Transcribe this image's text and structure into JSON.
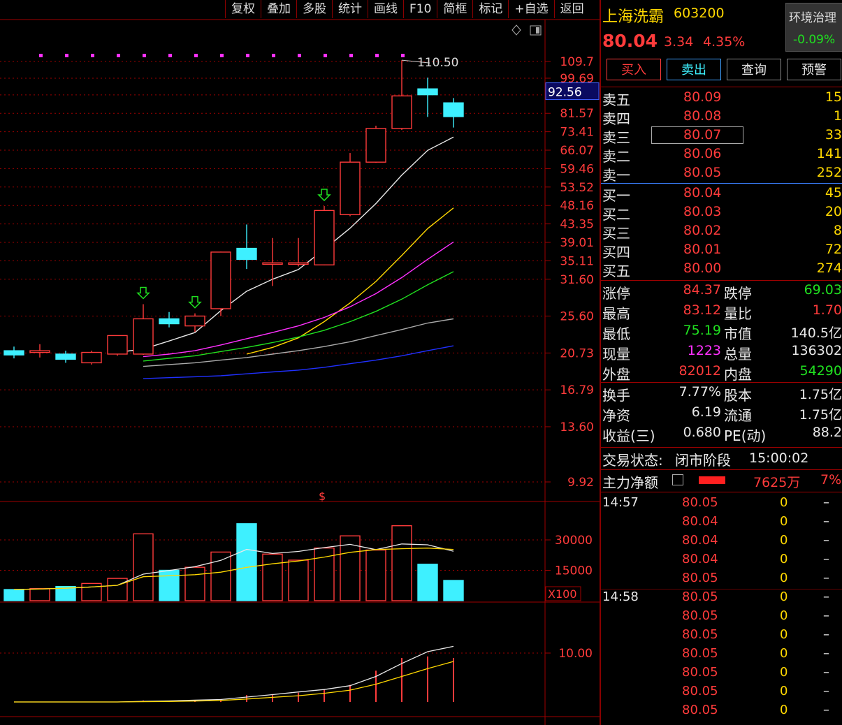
{
  "toolbar": [
    "复权",
    "叠加",
    "多股",
    "统计",
    "画线",
    "F10",
    "简框",
    "标记",
    "+自选",
    "返回"
  ],
  "stock": {
    "name": "上海洗霸",
    "code": "603200",
    "price": "80.04",
    "change": "3.34",
    "change_pct": "4.35%",
    "sector": "环境治理",
    "sector_change": "-0.09%"
  },
  "buttons": {
    "buy": "买入",
    "sell": "卖出",
    "query": "查询",
    "alert": "预警"
  },
  "order_book": {
    "asks": [
      {
        "label": "卖五",
        "price": "80.09",
        "vol": "15"
      },
      {
        "label": "卖四",
        "price": "80.08",
        "vol": "1"
      },
      {
        "label": "卖三",
        "price": "80.07",
        "vol": "33"
      },
      {
        "label": "卖二",
        "price": "80.06",
        "vol": "141"
      },
      {
        "label": "卖一",
        "price": "80.05",
        "vol": "252"
      }
    ],
    "bids": [
      {
        "label": "买一",
        "price": "80.04",
        "vol": "45"
      },
      {
        "label": "买二",
        "price": "80.03",
        "vol": "20"
      },
      {
        "label": "买三",
        "price": "80.02",
        "vol": "8"
      },
      {
        "label": "买四",
        "price": "80.01",
        "vol": "72"
      },
      {
        "label": "买五",
        "price": "80.00",
        "vol": "274"
      }
    ]
  },
  "stats": {
    "zt_label": "涨停",
    "zt": "84.37",
    "dt_label": "跌停",
    "dt": "69.03",
    "high_label": "最高",
    "high": "83.12",
    "lb_label": "量比",
    "lb": "1.70",
    "low_label": "最低",
    "low": "75.19",
    "mv_label": "市值",
    "mv": "140.5亿",
    "cur_vol_label": "现量",
    "cur_vol": "1223",
    "total_vol_label": "总量",
    "total_vol": "136302",
    "outer_label": "外盘",
    "outer": "82012",
    "inner_label": "内盘",
    "inner": "54290",
    "turnover_label": "换手",
    "turnover": "7.77%",
    "capital_label": "股本",
    "capital": "1.75亿",
    "nav_label": "净资",
    "nav": "6.19",
    "float_label": "流通",
    "float_cap": "1.75亿",
    "eps_label": "收益(三)",
    "eps": "0.680",
    "pe_label": "PE(动)",
    "pe": "88.2"
  },
  "status": {
    "label": "交易状态:",
    "state": "闭市阶段",
    "time": "15:00:02"
  },
  "main_flow": {
    "label": "主力净额",
    "amount": "7625万",
    "pct": "7%"
  },
  "ticks": [
    {
      "time": "14:57",
      "price": "80.05",
      "vol": "0",
      "dir": "–"
    },
    {
      "time": "",
      "price": "80.04",
      "vol": "0",
      "dir": "–"
    },
    {
      "time": "",
      "price": "80.04",
      "vol": "0",
      "dir": "–"
    },
    {
      "time": "",
      "price": "80.04",
      "vol": "0",
      "dir": "–"
    },
    {
      "time": "",
      "price": "80.05",
      "vol": "0",
      "dir": "–"
    },
    {
      "time": "14:58",
      "price": "80.05",
      "vol": "0",
      "dir": "–"
    },
    {
      "time": "",
      "price": "80.05",
      "vol": "0",
      "dir": "–"
    },
    {
      "time": "",
      "price": "80.05",
      "vol": "0",
      "dir": "–"
    },
    {
      "time": "",
      "price": "80.05",
      "vol": "0",
      "dir": "–"
    },
    {
      "time": "",
      "price": "80.05",
      "vol": "0",
      "dir": "–"
    },
    {
      "time": "",
      "price": "80.05",
      "vol": "0",
      "dir": "–"
    },
    {
      "time": "",
      "price": "80.05",
      "vol": "0",
      "dir": "–"
    }
  ],
  "colors": {
    "up": "#ff3b3b",
    "down": "#3ef0ff",
    "grid": "#a00000",
    "ma5": "#e8e8e8",
    "ma10": "#ffd800",
    "ma20": "#ff30ff",
    "ma30": "#20e020",
    "ma60": "#aaaaaa",
    "ma120": "#2030ff"
  },
  "chart_data": {
    "type": "candlestick",
    "price_axis_ticks": [
      "109.7",
      "99.69",
      "90.63",
      "81.57",
      "73.41",
      "66.07",
      "59.46",
      "53.52",
      "48.16",
      "43.35",
      "39.01",
      "35.11",
      "31.60",
      "25.60",
      "20.73",
      "16.79",
      "13.60",
      "9.92"
    ],
    "price_axis_scale": "log",
    "crosshair_price": "92.56",
    "max_label": "110.50",
    "candles": [
      {
        "o": 21.0,
        "h": 21.5,
        "l": 20.1,
        "c": 20.5
      },
      {
        "o": 20.8,
        "h": 21.8,
        "l": 20.2,
        "c": 21.0
      },
      {
        "o": 20.6,
        "h": 21.0,
        "l": 19.6,
        "c": 20.0
      },
      {
        "o": 19.6,
        "h": 21.0,
        "l": 19.4,
        "c": 20.8
      },
      {
        "o": 20.6,
        "h": 22.9,
        "l": 20.4,
        "c": 22.9
      },
      {
        "o": 20.6,
        "h": 27.4,
        "l": 20.5,
        "c": 25.2
      },
      {
        "o": 25.2,
        "h": 26.2,
        "l": 24.0,
        "c": 24.5
      },
      {
        "o": 24.2,
        "h": 26.0,
        "l": 23.4,
        "c": 25.6
      },
      {
        "o": 26.7,
        "h": 37.0,
        "l": 25.6,
        "c": 36.9
      },
      {
        "o": 37.7,
        "h": 43.2,
        "l": 33.5,
        "c": 35.4
      },
      {
        "o": 34.7,
        "h": 40.0,
        "l": 30.4,
        "c": 34.7
      },
      {
        "o": 34.5,
        "h": 40.0,
        "l": 34.0,
        "c": 34.7
      },
      {
        "o": 34.3,
        "h": 48.0,
        "l": 34.2,
        "c": 46.8
      },
      {
        "o": 45.7,
        "h": 65.0,
        "l": 45.3,
        "c": 61.7
      },
      {
        "o": 61.7,
        "h": 76.0,
        "l": 61.5,
        "c": 74.8
      },
      {
        "o": 74.8,
        "h": 110.5,
        "l": 74.2,
        "c": 90.1
      },
      {
        "o": 93.8,
        "h": 100.0,
        "l": 79.9,
        "c": 90.7
      },
      {
        "o": 86.6,
        "h": 89.0,
        "l": 75.19,
        "c": 80.04
      }
    ],
    "ma": [
      {
        "name": "MA5",
        "values": [
          null,
          null,
          null,
          null,
          20.8,
          21.2,
          22.2,
          23.3,
          26.4,
          29.5,
          31.6,
          33.4,
          37.5,
          42.3,
          48.7,
          57.3,
          66.0,
          71.2
        ]
      },
      {
        "name": "MA10",
        "values": [
          null,
          null,
          null,
          null,
          null,
          null,
          null,
          null,
          null,
          20.6,
          21.4,
          22.6,
          24.8,
          27.6,
          31.2,
          36.2,
          42.2,
          47.5,
          53.5,
          59.0
        ]
      },
      {
        "name": "MA20",
        "values": [
          null,
          null,
          null,
          null,
          null,
          20.3,
          20.6,
          21.0,
          21.7,
          22.5,
          23.3,
          24.2,
          25.4,
          27.0,
          29.1,
          31.9,
          35.4,
          39.1
        ]
      },
      {
        "name": "MA30",
        "values": [
          null,
          null,
          null,
          null,
          null,
          19.8,
          20.1,
          20.4,
          20.9,
          21.4,
          22.0,
          22.7,
          23.6,
          24.8,
          26.3,
          28.2,
          30.6,
          33.0
        ]
      },
      {
        "name": "MA60",
        "values": [
          null,
          null,
          null,
          null,
          null,
          19.2,
          19.4,
          19.6,
          19.9,
          20.2,
          20.6,
          21.0,
          21.5,
          22.1,
          22.9,
          23.7,
          24.6,
          25.2
        ]
      },
      {
        "name": "MA120",
        "values": [
          null,
          null,
          null,
          null,
          null,
          17.9,
          18.0,
          18.1,
          18.2,
          18.4,
          18.6,
          18.8,
          19.1,
          19.5,
          19.9,
          20.4,
          21.0,
          21.6
        ]
      }
    ],
    "volume_axis_ticks": [
      "30000",
      "15000"
    ],
    "volume_unit": "X100",
    "volume": [
      5500,
      6000,
      7000,
      8500,
      11000,
      33000,
      15000,
      16500,
      24000,
      38000,
      23000,
      20000,
      26000,
      32000,
      25000,
      37000,
      18000,
      10000
    ],
    "indicator_axis_ticks": [
      "10.00"
    ],
    "indicator_bars": [
      0,
      0,
      0,
      0,
      0,
      0.3,
      0.2,
      0.4,
      0.6,
      1.4,
      1.6,
      1.9,
      2.6,
      3.5,
      6.4,
      9.0,
      9.3,
      9.0
    ]
  }
}
